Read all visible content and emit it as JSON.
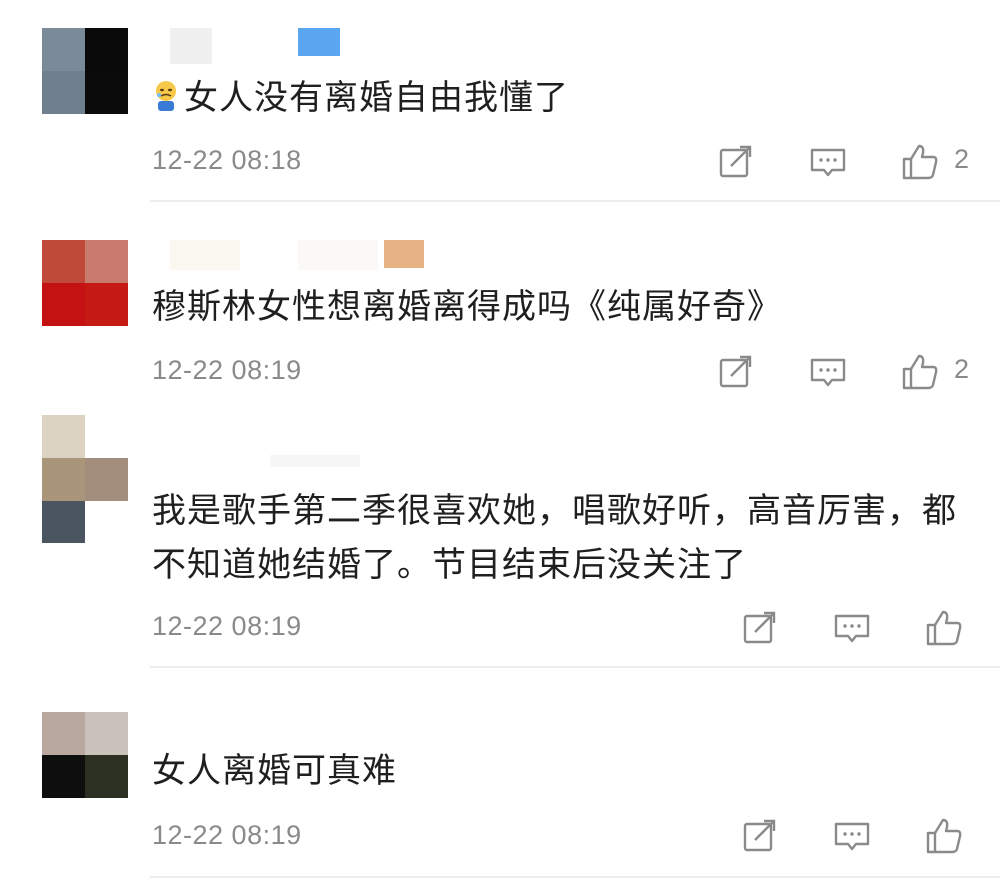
{
  "comments": [
    {
      "text": "女人没有离婚自由我懂了",
      "emoji": "crying-face-emoji",
      "time": "12-22 08:18",
      "likes": "2"
    },
    {
      "text": "穆斯林女性想离婚离得成吗《纯属好奇》",
      "time": "12-22 08:19",
      "likes": "2"
    },
    {
      "text_line1": "我是歌手第二季很喜欢她，唱歌好听，高音厉害，都",
      "text_line2": "不知道她结婚了。节目结束后没关注了",
      "time": "12-22 08:19",
      "likes": ""
    },
    {
      "text": "女人离婚可真难",
      "time": "12-22 08:19",
      "likes": ""
    }
  ],
  "icons": {
    "share": "share-icon",
    "reply": "comment-icon",
    "like": "thumbs-up-icon"
  },
  "colors": {
    "text": "#1f1f1f",
    "meta": "#8a8a8a",
    "divider": "#ededed"
  }
}
